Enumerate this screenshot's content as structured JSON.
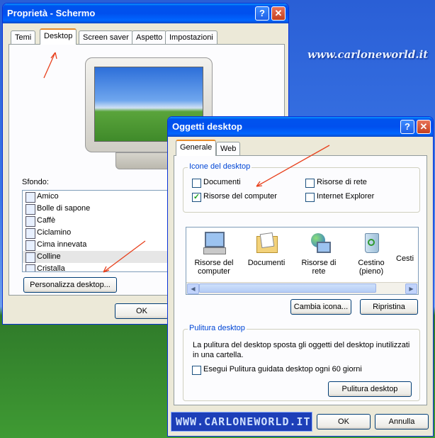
{
  "watermark_top": "www.carloneworld.it",
  "watermark_bottom": "WWW.CARLONEWORLD.IT",
  "display_props": {
    "title": "Proprietà - Schermo",
    "tabs": [
      "Temi",
      "Desktop",
      "Screen saver",
      "Aspetto",
      "Impostazioni"
    ],
    "active_tab": "Desktop",
    "background_label": "Sfondo:",
    "backgrounds": [
      "Amico",
      "Bolle di sapone",
      "Caffè",
      "Ciclamino",
      "Cima innevata",
      "Colline",
      "Cristalla"
    ],
    "selected_background": "Colline",
    "customize_button": "Personalizza desktop...",
    "ok_button": "OK"
  },
  "desktop_items": {
    "title": "Oggetti desktop",
    "tabs": [
      "Generale",
      "Web"
    ],
    "active_tab": "Generale",
    "icons_group_label": "Icone del desktop",
    "checkboxes": [
      {
        "label": "Documenti",
        "checked": false
      },
      {
        "label": "Risorse di rete",
        "checked": false
      },
      {
        "label": "Risorse del computer",
        "checked": true
      },
      {
        "label": "Internet Explorer",
        "checked": false
      }
    ],
    "icon_list": [
      {
        "label": "Risorse del computer",
        "icon": "computer-icon"
      },
      {
        "label": "Documenti",
        "icon": "documents-folder-icon"
      },
      {
        "label": "Risorse di rete",
        "icon": "network-icon"
      },
      {
        "label": "Cestino (pieno)",
        "icon": "recycle-bin-full-icon"
      },
      {
        "label": "Cesti",
        "icon": "recycle-bin-icon"
      }
    ],
    "change_icon_button": "Cambia icona...",
    "restore_button": "Ripristina",
    "cleanup_group_label": "Pulitura desktop",
    "cleanup_description": "La pulitura del desktop sposta gli oggetti del desktop inutilizzati in una cartella.",
    "cleanup_checkbox": "Esegui Pulitura guidata desktop ogni 60 giorni",
    "cleanup_checked": false,
    "cleanup_button": "Pulitura desktop",
    "ok_button": "OK",
    "cancel_button": "Annulla"
  },
  "colors": {
    "title_bar": "#0054e3",
    "dialog_bg": "#ece9d8",
    "annotation_arrow": "#e8401c",
    "selection": "#316ac5"
  }
}
